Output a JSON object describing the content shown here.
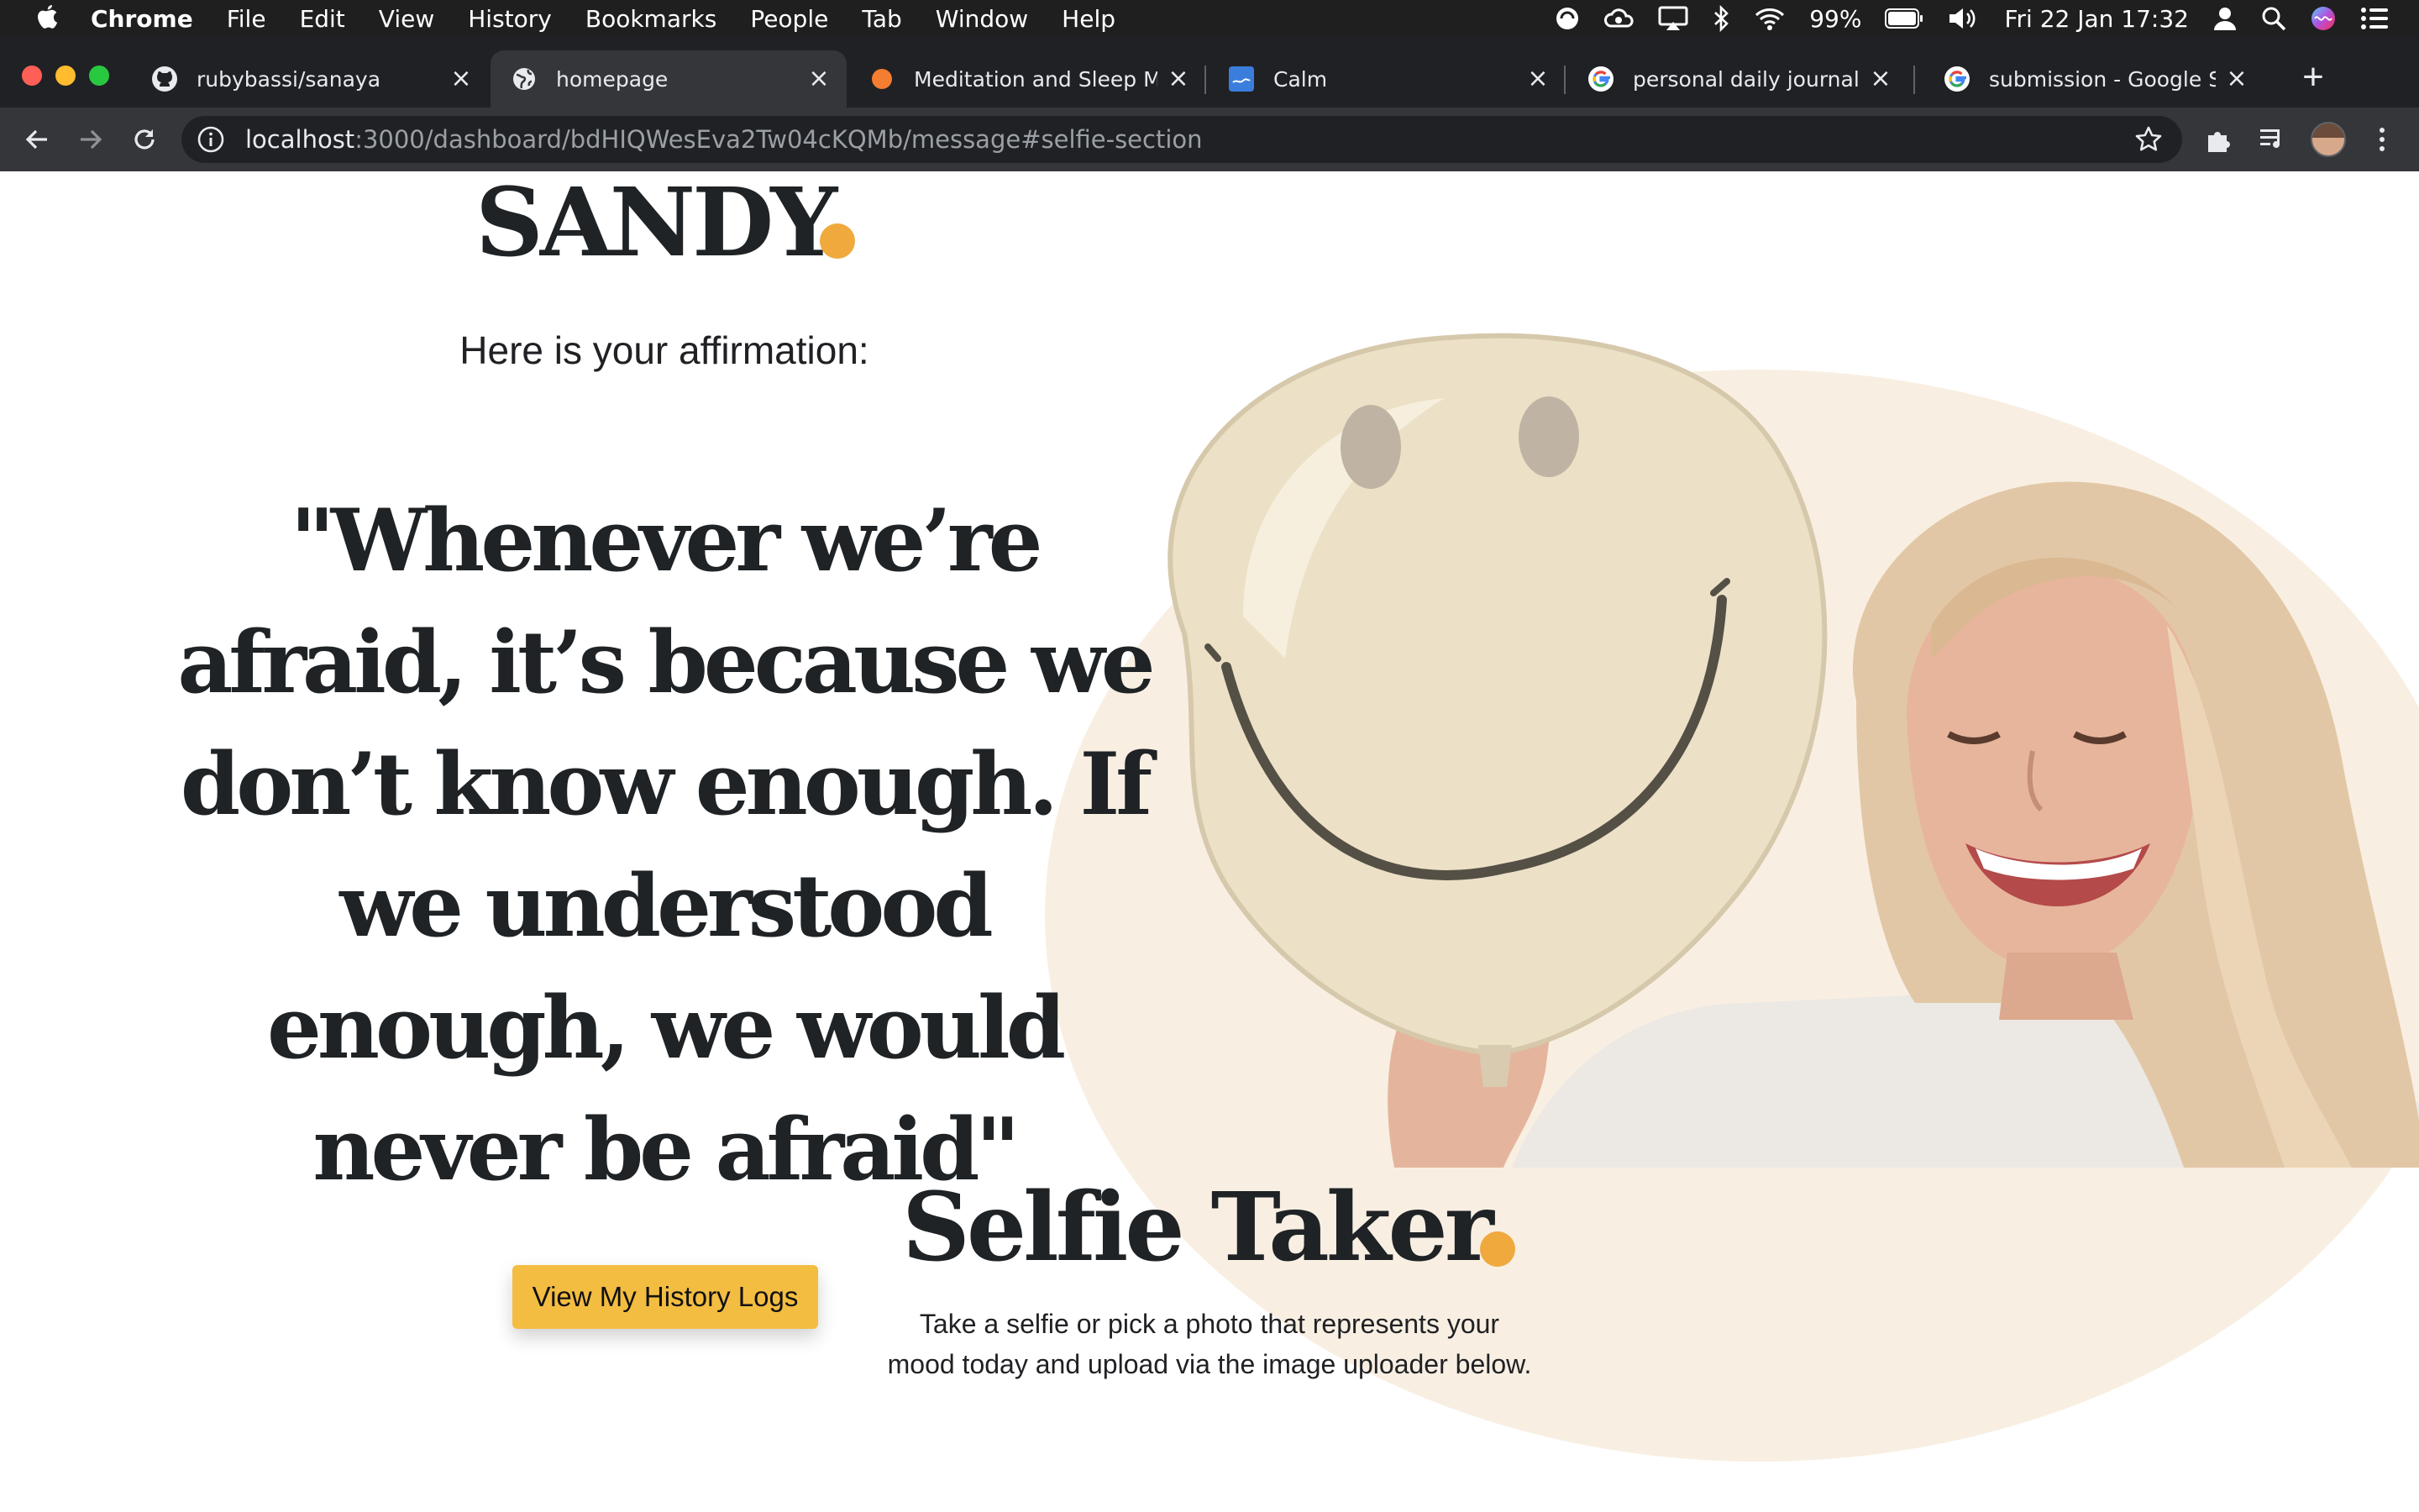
{
  "menubar": {
    "app": "Chrome",
    "items": [
      "File",
      "Edit",
      "View",
      "History",
      "Bookmarks",
      "People",
      "Tab",
      "Window",
      "Help"
    ],
    "battery": "99%",
    "datetime": "Fri 22 Jan  17:32"
  },
  "tabs": [
    {
      "title": "rubybassi/sanaya",
      "icon": "github-icon"
    },
    {
      "title": "homepage",
      "icon": "globe-icon",
      "active": true
    },
    {
      "title": "Meditation and Sleep Made Simple",
      "icon": "headspace-icon"
    },
    {
      "title": "Calm",
      "icon": "calm-icon"
    },
    {
      "title": "personal daily journal - Google Search",
      "icon": "google-icon"
    },
    {
      "title": "submission - Google Search",
      "icon": "google-icon"
    }
  ],
  "toolbar": {
    "url_host": "localhost",
    "url_rest": ":3000/dashboard/bdHIQWesEva2Tw04cKQMb/message#selfie-section"
  },
  "page": {
    "name": "SANDY",
    "intro": "Here is your affirmation:",
    "quote": "\"Whenever we’re afraid, it’s because we don’t know enough. If we understood enough, we would never be afraid\"",
    "history_button": "View My History Logs",
    "selfie_title": "Selfie Taker",
    "selfie_desc_line1": "Take a selfie or pick a photo that represents your",
    "selfie_desc_line2": "mood today and upload via the image uploader below."
  },
  "colors": {
    "accent_dot": "#f0a93d",
    "button": "#f3bd42",
    "hero_blob": "#f8efe2",
    "text_dark": "#1f2326"
  }
}
